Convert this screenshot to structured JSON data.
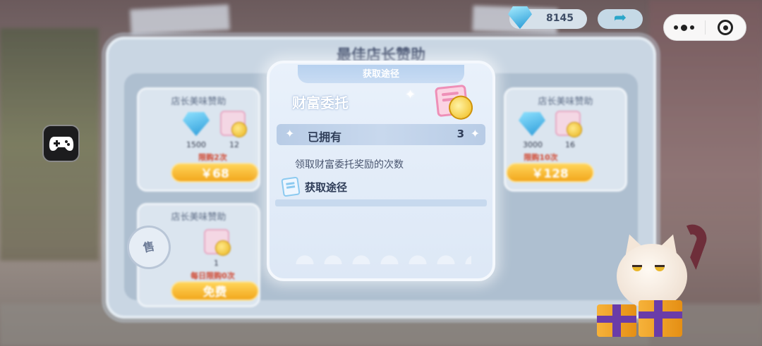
{
  "shop": {
    "title": "最佳店长赞助",
    "cards": [
      {
        "title": "店长美味赞助",
        "gem_qty": "1500",
        "ticket_qty": "12",
        "limit": "限购2次",
        "price": "￥68"
      },
      {
        "title": "店长美味赞助",
        "gem_qty": "3000",
        "ticket_qty": "16",
        "limit": "限购10次",
        "price": "￥128"
      },
      {
        "title": "店长美味赞助",
        "ticket_qty": "1",
        "limit": "每日限购0次",
        "price": "免费",
        "stamp": "售"
      }
    ]
  },
  "topbar": {
    "gem_count": "8145",
    "share_symbol": "➦"
  },
  "popup": {
    "header": "获取途径",
    "item_name": "财富委托",
    "owned_label": "已拥有",
    "owned_value": "3",
    "description": "领取财富委托奖励的次数",
    "source_label": "获取途径"
  },
  "colors": {
    "price_button": "#f2a71d",
    "limit_text": "#d0452e",
    "popup_bg": "#e3ecf8",
    "header_text": "#3e4b6a"
  },
  "icons": [
    "gem-icon",
    "ticket-coin-icon",
    "share-arrow-icon",
    "more-icon",
    "close-icon",
    "gamepad-icon",
    "sparkle-icon",
    "scroll-icon",
    "cat-mascot",
    "gift-box-icon"
  ]
}
